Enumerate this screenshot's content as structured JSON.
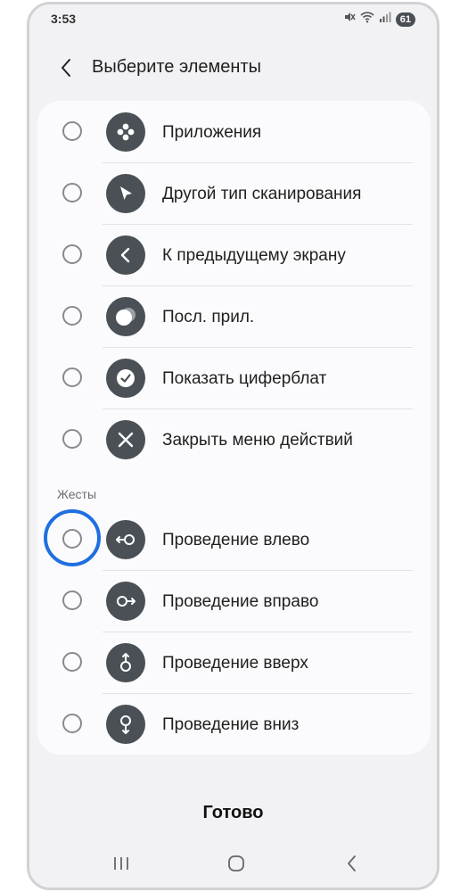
{
  "status_bar": {
    "time": "3:53",
    "battery": "61"
  },
  "header": {
    "title": "Выберите элементы"
  },
  "section_header": "Жесты",
  "items": [
    {
      "label": "Приложения",
      "icon": "apps-icon"
    },
    {
      "label": "Другой тип сканирования",
      "icon": "pointer-icon"
    },
    {
      "label": "К предыдущему экрану",
      "icon": "back-icon"
    },
    {
      "label": "Посл. прил.",
      "icon": "recent-apps-icon"
    },
    {
      "label": "Показать циферблат",
      "icon": "clock-icon"
    },
    {
      "label": "Закрыть меню действий",
      "icon": "close-icon"
    }
  ],
  "gestures": [
    {
      "label": "Проведение влево",
      "icon": "swipe-left-icon"
    },
    {
      "label": "Проведение вправо",
      "icon": "swipe-right-icon"
    },
    {
      "label": "Проведение вверх",
      "icon": "swipe-up-icon"
    },
    {
      "label": "Проведение вниз",
      "icon": "swipe-down-icon"
    }
  ],
  "done_label": "Готово",
  "colors": {
    "highlight": "#1f6fe0",
    "icon_bg": "#4a5056",
    "card_bg": "#fbfbfd",
    "screen_bg": "#f2f2f5"
  }
}
